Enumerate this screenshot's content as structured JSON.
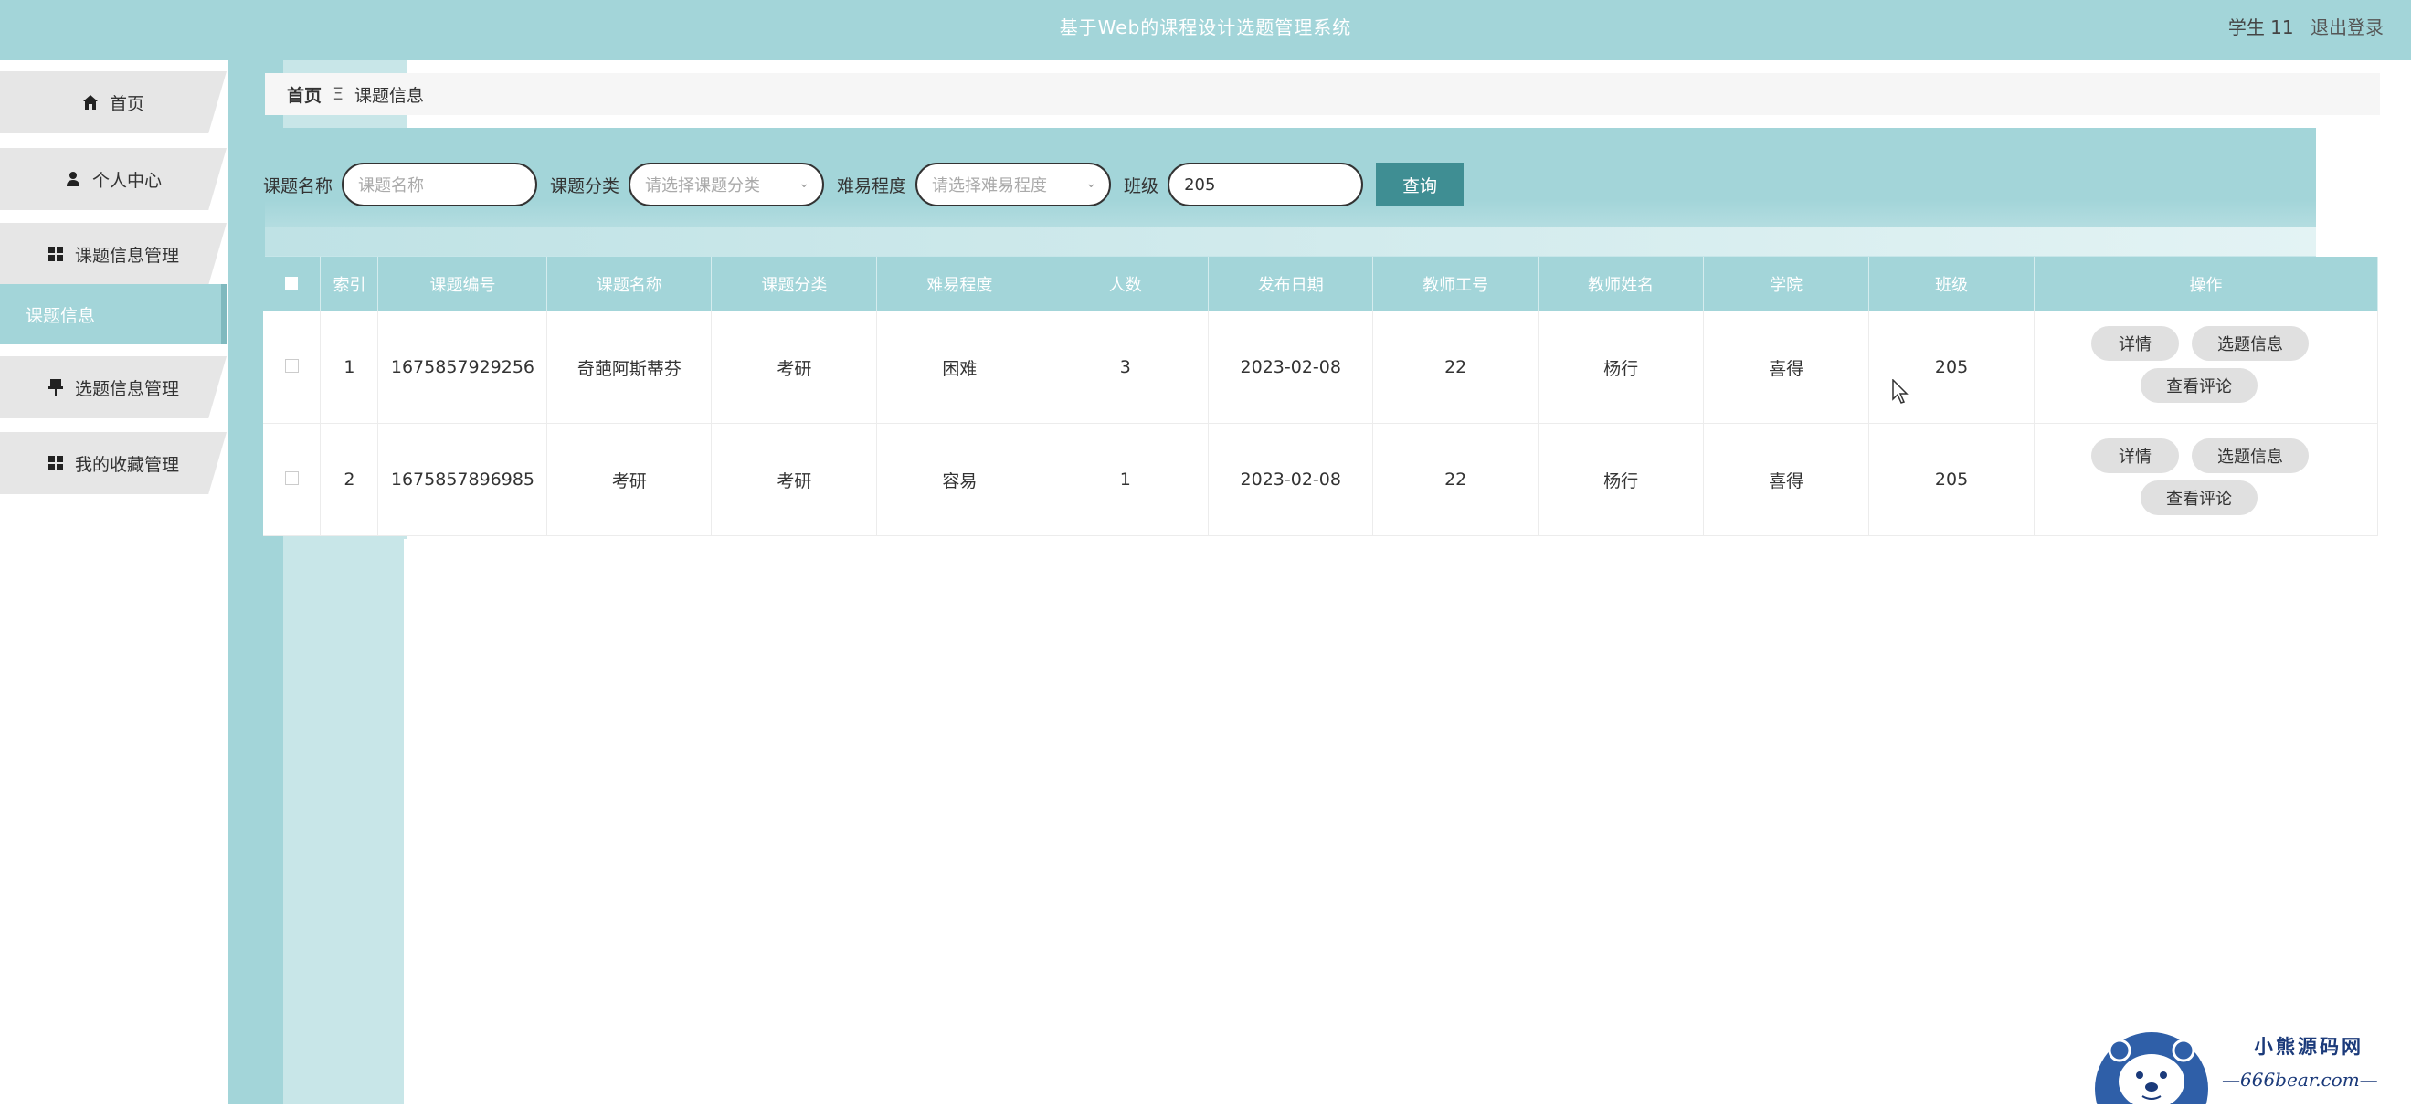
{
  "header": {
    "title": "基于Web的课程设计选题管理系统",
    "user": "学生 11",
    "logout": "退出登录"
  },
  "sidebar": {
    "items": [
      {
        "label": "首页",
        "icon": "home-icon"
      },
      {
        "label": "个人中心",
        "icon": "user-icon"
      },
      {
        "label": "课题信息管理",
        "icon": "grid-icon"
      },
      {
        "label": "课题信息",
        "icon": "",
        "active": true
      },
      {
        "label": "选题信息管理",
        "icon": "pin-icon"
      },
      {
        "label": "我的收藏管理",
        "icon": "grid-icon"
      }
    ]
  },
  "breadcrumb": {
    "home": "首页",
    "separator": "Ξ",
    "current": "课题信息"
  },
  "search": {
    "name_label": "课题名称",
    "name_placeholder": "课题名称",
    "category_label": "课题分类",
    "category_placeholder": "请选择课题分类",
    "difficulty_label": "难易程度",
    "difficulty_placeholder": "请选择难易程度",
    "class_label": "班级",
    "class_value": "205",
    "query_button": "查询"
  },
  "table": {
    "headers": [
      "索引",
      "课题编号",
      "课题名称",
      "课题分类",
      "难易程度",
      "人数",
      "发布日期",
      "教师工号",
      "教师姓名",
      "学院",
      "班级",
      "操作"
    ],
    "rows": [
      {
        "index": "1",
        "code": "1675857929256",
        "name": "奇葩阿斯蒂芬",
        "category": "考研",
        "difficulty": "困难",
        "count": "3",
        "date": "2023-02-08",
        "teacher_id": "22",
        "teacher_name": "杨行",
        "college": "喜得",
        "class": "205"
      },
      {
        "index": "2",
        "code": "1675857896985",
        "name": "考研",
        "category": "考研",
        "difficulty": "容易",
        "count": "1",
        "date": "2023-02-08",
        "teacher_id": "22",
        "teacher_name": "杨行",
        "college": "喜得",
        "class": "205"
      }
    ],
    "actions": {
      "detail": "详情",
      "select": "选题信息",
      "comments": "查看评论"
    }
  },
  "watermark": {
    "line1": "小熊源码网",
    "line2": "—666bear.com—"
  },
  "colors": {
    "accent": "#a3d5d9",
    "button": "#3f8e93",
    "watermark": "#1b3a7a"
  }
}
